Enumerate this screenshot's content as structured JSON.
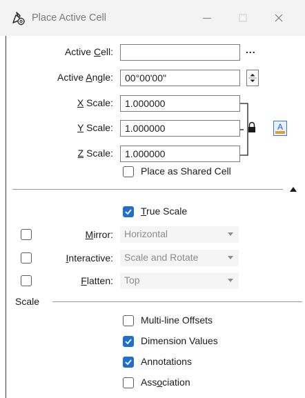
{
  "window": {
    "title": "Place Active Cell",
    "icon": "place-cell-tool-icon",
    "minimize_icon": "minimize-icon",
    "maximize_icon": "maximize-icon",
    "close_icon": "close-icon"
  },
  "form": {
    "active_cell": {
      "label_pre": "Active ",
      "label_key": "C",
      "label_post": "ell:",
      "value": "",
      "browse_label": "..."
    },
    "active_angle": {
      "label_pre": "Active ",
      "label_key": "A",
      "label_post": "ngle:",
      "value": "00°00'00\""
    },
    "x_scale": {
      "label_key": "X",
      "label_post": " Scale:",
      "value": "1.000000"
    },
    "y_scale": {
      "label_key": "Y",
      "label_post": " Scale:",
      "value": "1.000000"
    },
    "z_scale": {
      "label_key": "Z",
      "label_post": " Scale:",
      "value": "1.000000"
    },
    "lock_icon": "lock-icon",
    "annotation_scale_icon": "annotation-scale-icon",
    "annotation_scale_glyph": "A",
    "place_as_shared_cell": {
      "label": "Place as Shared Cell",
      "checked": false
    }
  },
  "collapse_icon": "triangle-up-icon",
  "options": {
    "true_scale": {
      "label_key": "T",
      "label_post": "rue Scale",
      "checked": true
    },
    "mirror": {
      "label_key": "M",
      "label_post": "irror:",
      "checked": false,
      "value": "Horizontal"
    },
    "interactive": {
      "label_key": "I",
      "label_post": "nteractive:",
      "checked": false,
      "value": "Scale and Rotate"
    },
    "flatten": {
      "label_key": "F",
      "label_post": "latten:",
      "checked": false,
      "value": "Top"
    }
  },
  "scale_section": {
    "title": "Scale",
    "multi_line_offsets": {
      "label": "Multi-line Offsets",
      "checked": false
    },
    "dimension_values": {
      "label": "Dimension Values",
      "checked": true
    },
    "annotations": {
      "label": "Annotations",
      "checked": true
    },
    "association": {
      "label_pre": "Ass",
      "label_key": "o",
      "label_post": "ciation",
      "checked": false
    }
  }
}
